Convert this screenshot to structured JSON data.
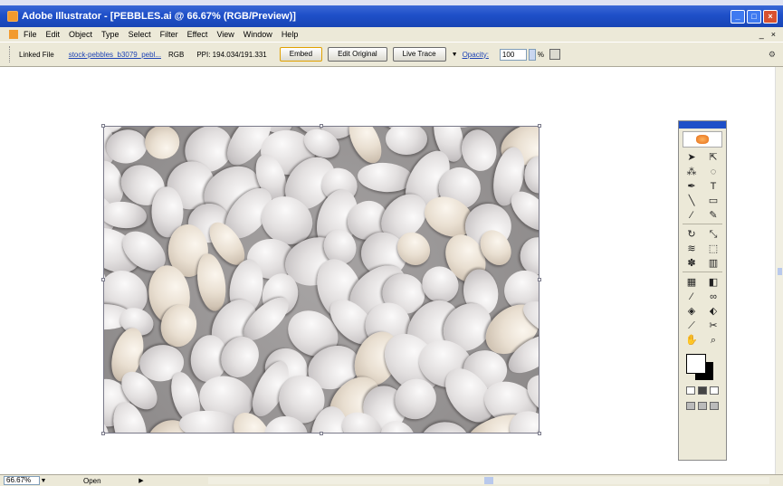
{
  "window": {
    "title": "Adobe Illustrator - [PEBBLES.ai @ 66.67% (RGB/Preview)]",
    "controls": [
      "_",
      "□",
      "×"
    ]
  },
  "menubar": {
    "items": [
      "File",
      "Edit",
      "Object",
      "Type",
      "Select",
      "Filter",
      "Effect",
      "View",
      "Window",
      "Help"
    ],
    "mdi_controls": [
      "_",
      "×"
    ]
  },
  "controlbar": {
    "label": "Linked File",
    "link_text": "stock-pebbles_b3079_pebl...",
    "color_mode": "RGB",
    "ppi": "PPI: 194.034/191.331",
    "buttons": {
      "embed": "Embed",
      "edit_original": "Edit Original",
      "live_trace": "Live Trace"
    },
    "opacity_label": "Opacity:",
    "opacity_value": "100",
    "percent": "%"
  },
  "tools_panel": {
    "logo": "illustrator-flower-icon",
    "tools": [
      "selection",
      "direct-selection",
      "magic-wand",
      "lasso",
      "pen",
      "type",
      "line-segment",
      "rectangle",
      "paintbrush",
      "pencil",
      "rotate",
      "scale",
      "warp",
      "free-transform",
      "symbol-sprayer",
      "column-graph",
      "mesh",
      "gradient",
      "eyedropper",
      "blend",
      "live-paint",
      "live-paint-selection",
      "slice",
      "scissors",
      "hand",
      "zoom"
    ]
  },
  "colors": {
    "title_bar": "#1e4fc8",
    "chrome": "#ece9d8",
    "fill": "#ffffff",
    "stroke": "#000000"
  },
  "statusbar": {
    "zoom": "66.67%",
    "status": "Open"
  }
}
